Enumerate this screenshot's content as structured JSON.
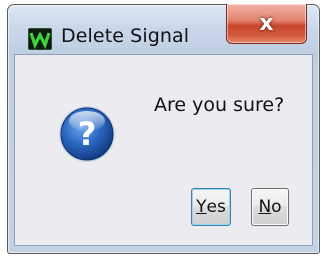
{
  "window": {
    "title": "Delete Signal",
    "app_icon": "waveform-app-icon",
    "close_glyph": "x"
  },
  "dialog": {
    "icon": "question-icon",
    "message": "Are you sure?",
    "buttons": {
      "yes": {
        "mnemonic": "Y",
        "rest": "es"
      },
      "no": {
        "mnemonic": "N",
        "rest": "o"
      }
    }
  },
  "colors": {
    "close_button": "#c7462b",
    "question_icon": "#1f5fb4"
  }
}
